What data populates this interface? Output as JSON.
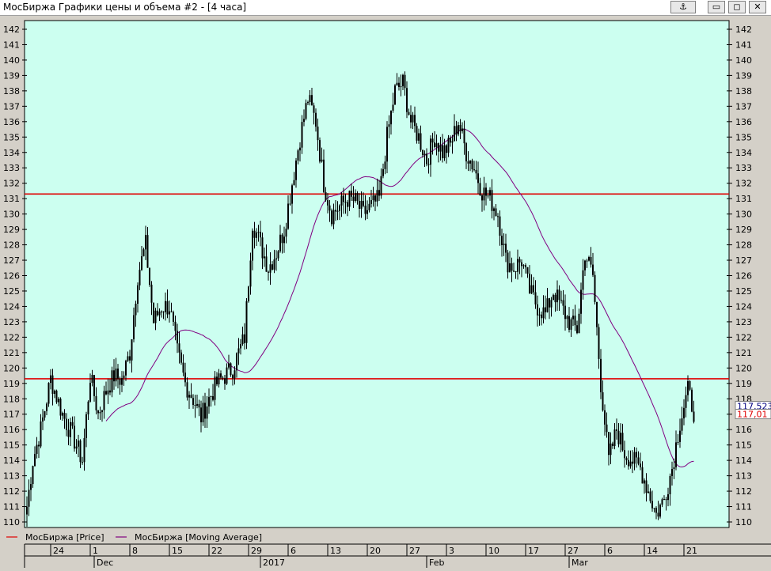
{
  "window": {
    "title": "МосБиржа Графики цены и объема #2 - [4 часа]",
    "buttons": [
      "⚓",
      "▭",
      "◻",
      "✕"
    ]
  },
  "chart_data": {
    "type": "candlestick",
    "ylim": [
      109.5,
      143
    ],
    "yticks": [
      110,
      111,
      112,
      113,
      114,
      115,
      116,
      117,
      118,
      119,
      120,
      121,
      122,
      123,
      124,
      125,
      126,
      127,
      128,
      129,
      130,
      131,
      132,
      133,
      134,
      135,
      136,
      137,
      138,
      139,
      140,
      141,
      142
    ],
    "bars_per_day": 2,
    "hlines": [
      131.3,
      119.3
    ],
    "last_labels": [
      "117,5233",
      "117,01"
    ],
    "legend": [
      "МосБиржа [Price]",
      "МосБиржа [Moving Average]"
    ],
    "day_labels": [
      "24",
      "1",
      "8",
      "15",
      "22",
      "29",
      "6",
      "13",
      "20",
      "27",
      "3",
      "10",
      "17",
      "27",
      "6",
      "14",
      "21"
    ],
    "day_label_index": [
      12,
      32,
      52,
      72,
      92,
      112,
      132,
      152,
      172,
      192,
      212,
      232,
      252,
      272,
      292,
      312,
      332
    ],
    "month_labels": [
      "Dec",
      "2017",
      "Feb",
      "Mar"
    ],
    "month_label_index": [
      34,
      118,
      202,
      274
    ],
    "waypoints": [
      [
        0,
        111
      ],
      [
        3,
        114
      ],
      [
        7,
        116
      ],
      [
        12,
        119.3
      ],
      [
        18,
        117
      ],
      [
        24,
        115.3
      ],
      [
        28,
        114
      ],
      [
        32,
        119.5
      ],
      [
        36,
        117
      ],
      [
        40,
        118.5
      ],
      [
        44,
        119.5
      ],
      [
        48,
        119.2
      ],
      [
        52,
        121
      ],
      [
        56,
        126
      ],
      [
        60,
        128
      ],
      [
        64,
        123
      ],
      [
        68,
        124
      ],
      [
        72,
        124
      ],
      [
        76,
        121
      ],
      [
        80,
        119
      ],
      [
        84,
        118
      ],
      [
        88,
        116.8
      ],
      [
        92,
        118
      ],
      [
        96,
        119
      ],
      [
        100,
        119.5
      ],
      [
        104,
        120
      ],
      [
        110,
        122
      ],
      [
        114,
        129.5
      ],
      [
        118,
        128
      ],
      [
        122,
        126.5
      ],
      [
        126,
        127.5
      ],
      [
        130,
        129
      ],
      [
        134,
        132
      ],
      [
        138,
        135
      ],
      [
        142,
        137.5
      ],
      [
        146,
        136
      ],
      [
        150,
        132
      ],
      [
        154,
        130
      ],
      [
        158,
        130.5
      ],
      [
        162,
        131
      ],
      [
        166,
        130.8
      ],
      [
        170,
        130
      ],
      [
        174,
        130.5
      ],
      [
        178,
        131
      ],
      [
        182,
        135
      ],
      [
        186,
        138
      ],
      [
        190,
        138.5
      ],
      [
        194,
        136
      ],
      [
        198,
        135
      ],
      [
        202,
        133.5
      ],
      [
        206,
        135
      ],
      [
        210,
        134
      ],
      [
        214,
        134.5
      ],
      [
        218,
        136
      ],
      [
        222,
        134
      ],
      [
        226,
        133
      ],
      [
        230,
        131.5
      ],
      [
        234,
        131
      ],
      [
        238,
        130
      ],
      [
        242,
        127
      ],
      [
        246,
        126.5
      ],
      [
        250,
        127
      ],
      [
        254,
        125
      ],
      [
        258,
        124
      ],
      [
        262,
        123.5
      ],
      [
        266,
        125
      ],
      [
        270,
        124
      ],
      [
        274,
        123
      ],
      [
        278,
        122.5
      ],
      [
        282,
        127.5
      ],
      [
        286,
        126
      ],
      [
        290,
        119
      ],
      [
        294,
        114
      ],
      [
        298,
        116
      ],
      [
        302,
        114.5
      ],
      [
        306,
        114
      ],
      [
        310,
        113.5
      ],
      [
        314,
        112
      ],
      [
        318,
        110.5
      ],
      [
        322,
        111.5
      ],
      [
        326,
        113.5
      ],
      [
        330,
        116.5
      ],
      [
        334,
        118.5
      ],
      [
        337,
        117.2
      ]
    ]
  }
}
